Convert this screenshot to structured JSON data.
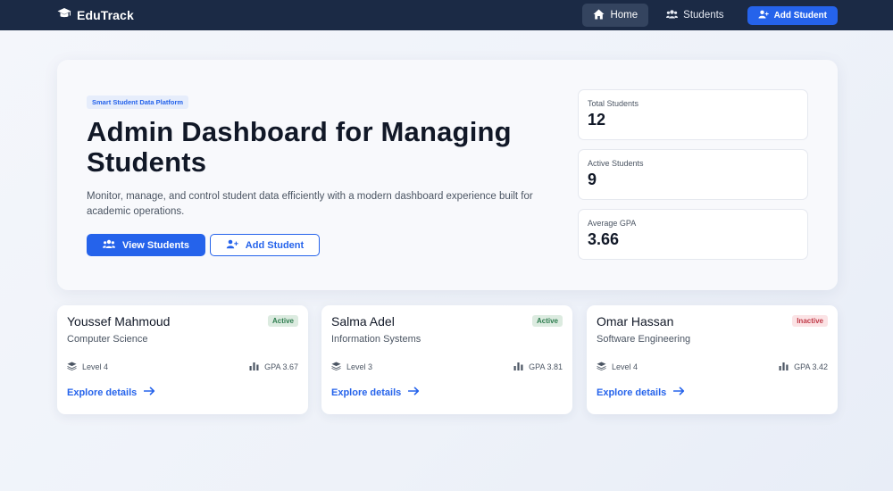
{
  "nav": {
    "brand": "EduTrack",
    "links": [
      {
        "label": "Home",
        "icon": "home-icon",
        "active": true
      },
      {
        "label": "Students",
        "icon": "users-icon",
        "active": false
      }
    ],
    "cta": "Add Student"
  },
  "hero": {
    "tag": "Smart Student Data Platform",
    "title": "Admin Dashboard for Managing Students",
    "description": "Monitor, manage, and control student data efficiently with a modern dashboard experience built for academic operations.",
    "primary_button": "View Students",
    "secondary_button": "Add Student"
  },
  "stats": [
    {
      "label": "Total Students",
      "value": "12"
    },
    {
      "label": "Active Students",
      "value": "9"
    },
    {
      "label": "Average GPA",
      "value": "3.66"
    }
  ],
  "students": [
    {
      "name": "Youssef Mahmoud",
      "major": "Computer Science",
      "status": "Active",
      "level": "Level 4",
      "gpa": "GPA 3.67",
      "link": "Explore details"
    },
    {
      "name": "Salma Adel",
      "major": "Information Systems",
      "status": "Active",
      "level": "Level 3",
      "gpa": "GPA 3.81",
      "link": "Explore details"
    },
    {
      "name": "Omar Hassan",
      "major": "Software Engineering",
      "status": "Inactive",
      "level": "Level 4",
      "gpa": "GPA 3.42",
      "link": "Explore details"
    }
  ],
  "colors": {
    "nav_bg": "#1b2a45",
    "accent": "#2563eb",
    "active_badge": "#2e7d4f",
    "inactive_badge": "#c03947"
  }
}
